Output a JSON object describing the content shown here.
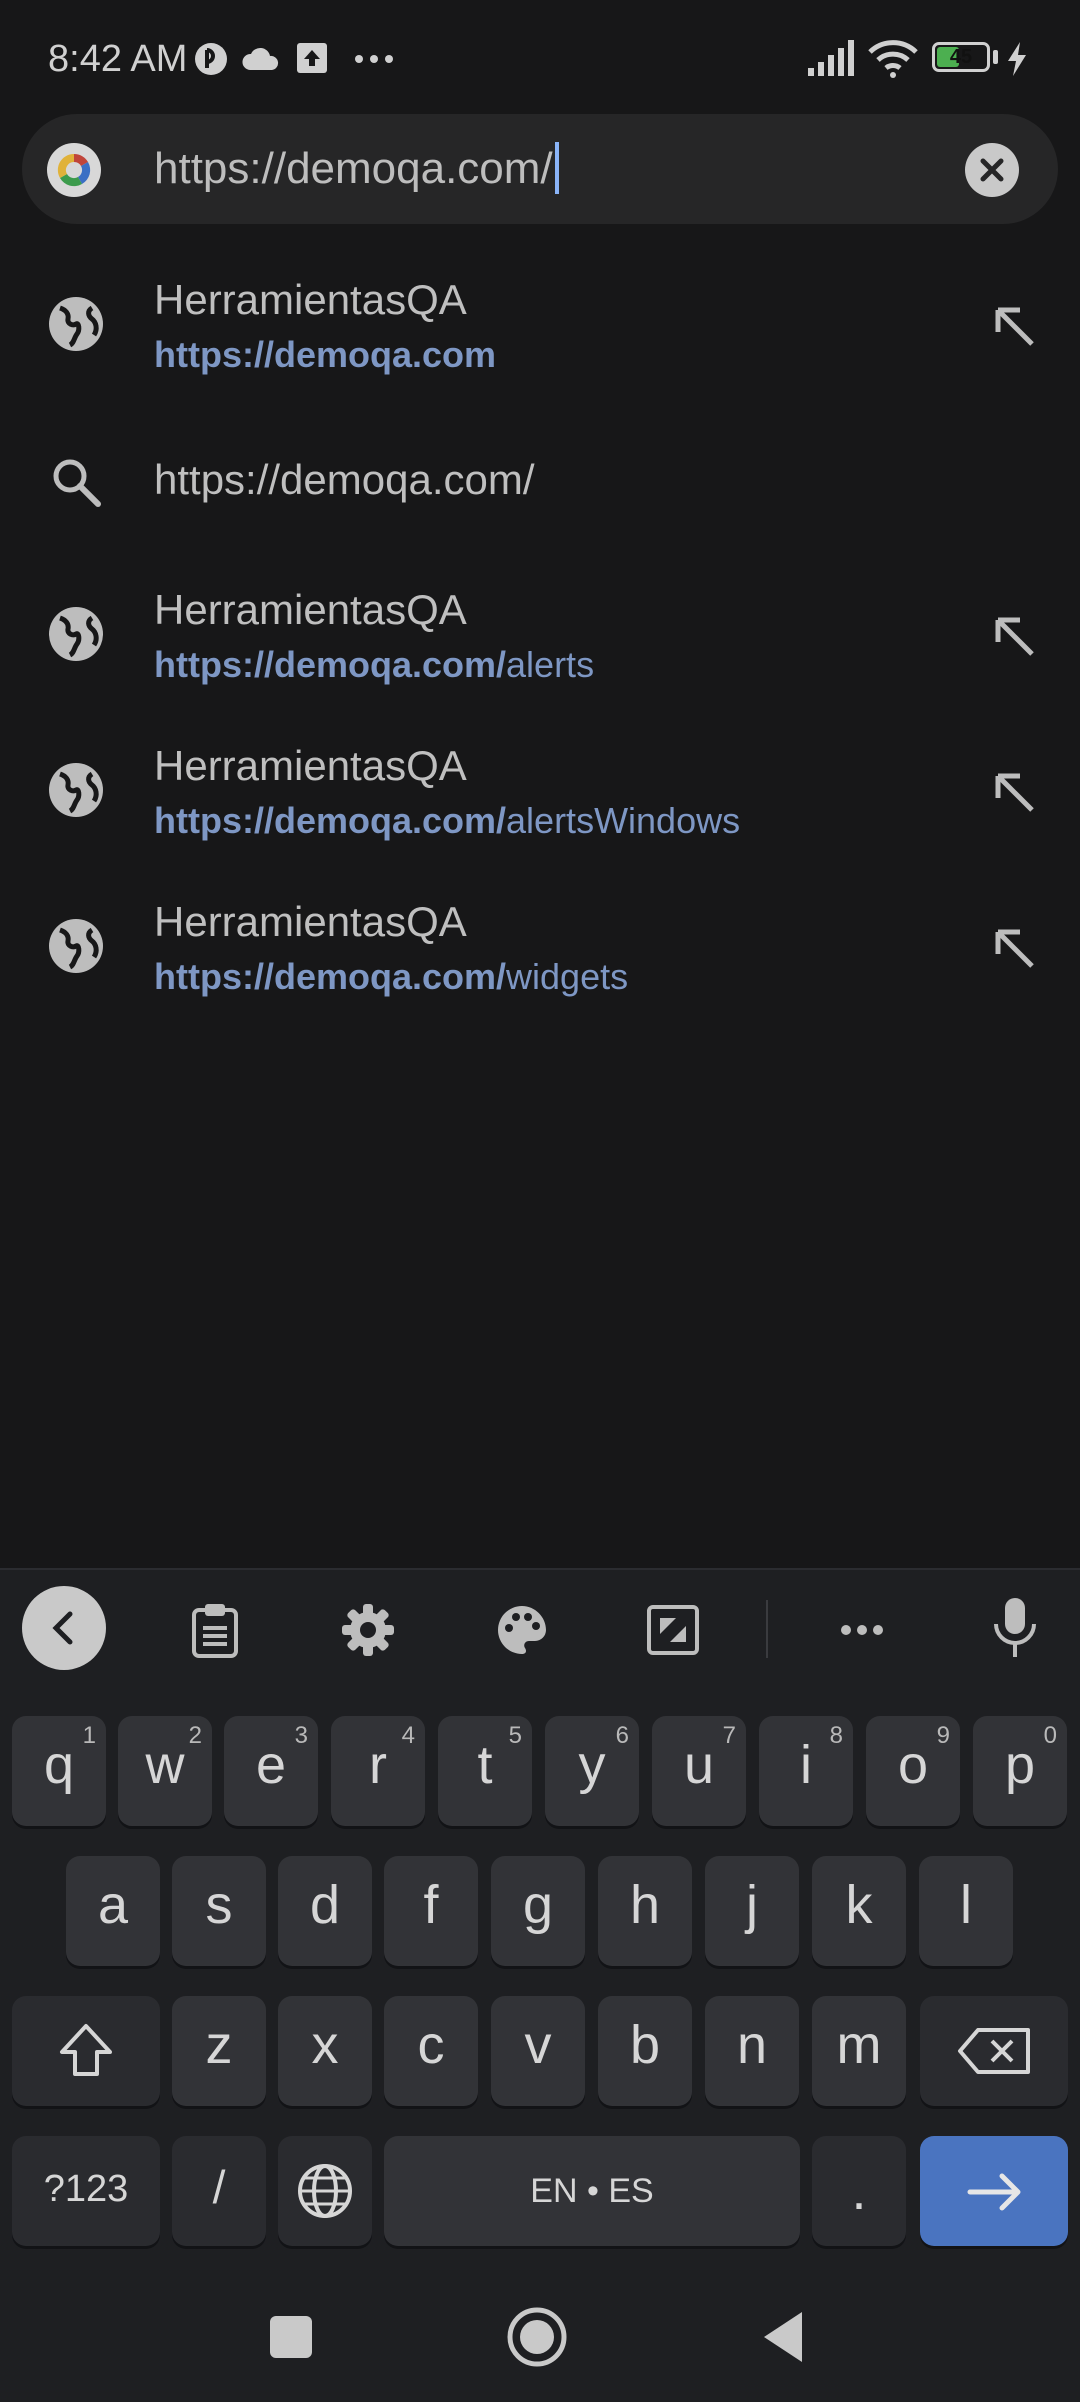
{
  "status_bar": {
    "time": "8:42 AM",
    "battery": "45",
    "icons": [
      "app-icon",
      "cloud-icon",
      "upload-icon",
      "more-icon",
      "signal-icon",
      "wifi-icon",
      "battery-icon",
      "charging-icon"
    ]
  },
  "omnibox": {
    "url": "https://demoqa.com/",
    "icon": "google-logo-icon",
    "clear_icon": "clear-icon"
  },
  "suggestions": [
    {
      "type": "history",
      "title": "HerramientasQA",
      "url_bold": "https://demoqa.com",
      "url_rest": "",
      "icon": "globe-icon"
    },
    {
      "type": "search",
      "title": "https://demoqa.com/",
      "icon": "search-icon"
    },
    {
      "type": "history",
      "title": "HerramientasQA",
      "url_bold": "https://demoqa.com/",
      "url_rest": "alerts",
      "icon": "globe-icon"
    },
    {
      "type": "history",
      "title": "HerramientasQA",
      "url_bold": "https://demoqa.com/",
      "url_rest": "alertsWindows",
      "icon": "globe-icon"
    },
    {
      "type": "history",
      "title": "HerramientasQA",
      "url_bold": "https://demoqa.com/",
      "url_rest": "widgets",
      "icon": "globe-icon"
    }
  ],
  "keyboard": {
    "toolbar": [
      "back-icon",
      "clipboard-icon",
      "settings-icon",
      "palette-icon",
      "resize-icon",
      "more-icon",
      "mic-icon"
    ],
    "row1": [
      {
        "k": "q",
        "n": "1"
      },
      {
        "k": "w",
        "n": "2"
      },
      {
        "k": "e",
        "n": "3"
      },
      {
        "k": "r",
        "n": "4"
      },
      {
        "k": "t",
        "n": "5"
      },
      {
        "k": "y",
        "n": "6"
      },
      {
        "k": "u",
        "n": "7"
      },
      {
        "k": "i",
        "n": "8"
      },
      {
        "k": "o",
        "n": "9"
      },
      {
        "k": "p",
        "n": "0"
      }
    ],
    "row2": [
      "a",
      "s",
      "d",
      "f",
      "g",
      "h",
      "j",
      "k",
      "l"
    ],
    "row3": [
      "z",
      "x",
      "c",
      "v",
      "b",
      "n",
      "m"
    ],
    "symbols_label": "?123",
    "slash_label": "/",
    "space_label": "EN • ES",
    "period_label": ".",
    "enter_color": "#4a74c0"
  },
  "nav_bar": [
    "recents-icon",
    "home-icon",
    "back-icon"
  ]
}
